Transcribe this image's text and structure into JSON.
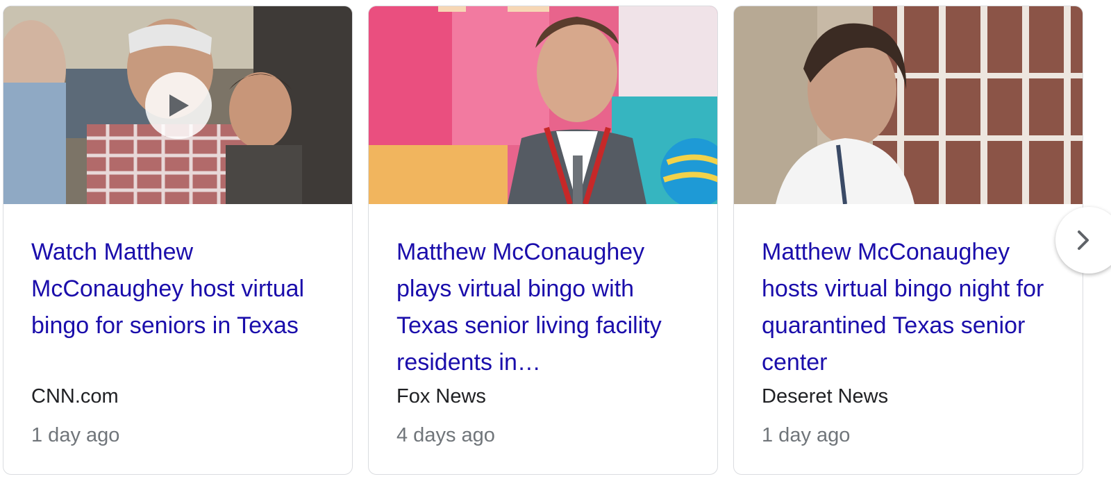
{
  "articles": [
    {
      "headline": "Watch Matthew McConaughey host virtual bingo for seniors in Texas",
      "source": "CNN.com",
      "time": "1 day ago",
      "has_video": true
    },
    {
      "headline": "Matthew McConaughey plays virtual bingo with Texas senior living facility residents in…",
      "source": "Fox News",
      "time": "4 days ago",
      "has_video": false
    },
    {
      "headline": "Matthew McConaughey hosts virtual bingo night for quarantined Texas senior center",
      "source": "Deseret News",
      "time": "1 day ago",
      "has_video": false
    }
  ],
  "icons": {
    "play": "play-icon",
    "next": "chevron-right-icon"
  },
  "colors": {
    "headline": "#1a0dab",
    "source": "#202124",
    "time": "#70757a",
    "border": "#dadce0"
  }
}
